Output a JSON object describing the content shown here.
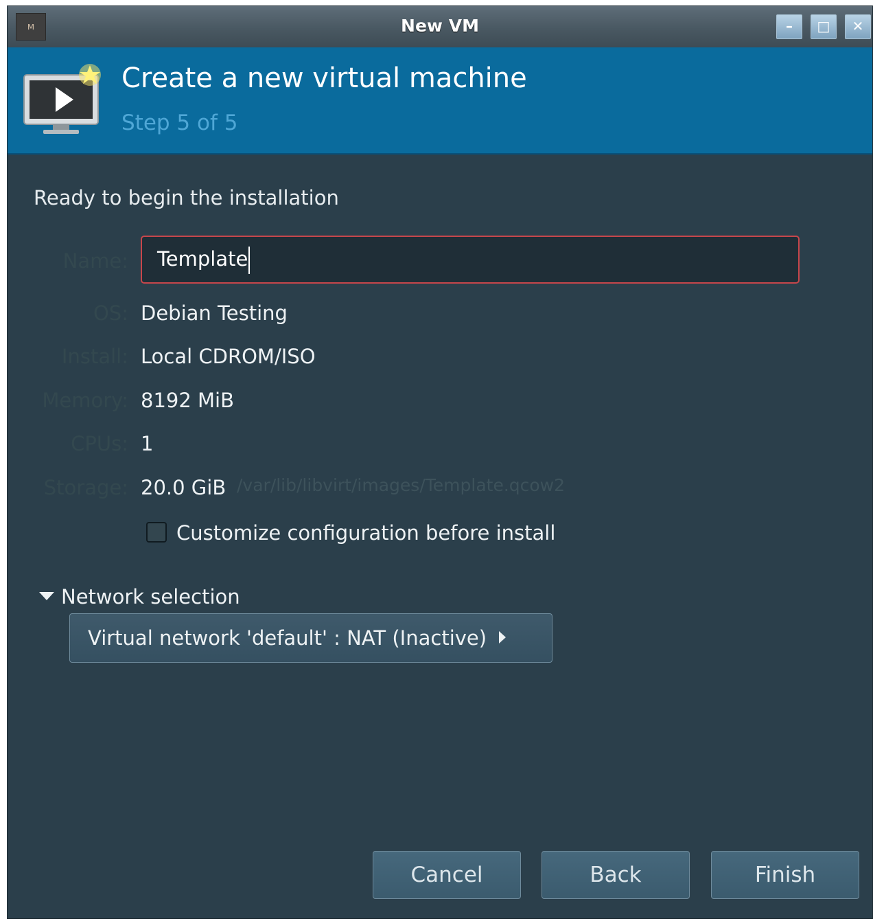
{
  "window": {
    "title": "New VM",
    "app_icon": "virt-manager-icon",
    "controls": {
      "minimize": "minimize-icon",
      "maximize": "maximize-icon",
      "close": "close-icon"
    }
  },
  "header": {
    "title": "Create a new virtual machine",
    "step": "Step 5 of 5",
    "icon": "new-vm-monitor-icon"
  },
  "summary": {
    "heading": "Ready to begin the installation",
    "name_label": "Name:",
    "name_value": "Template",
    "os_label": "OS:",
    "os_value": "Debian Testing",
    "install_label": "Install:",
    "install_value": "Local CDROM/ISO",
    "memory_label": "Memory:",
    "memory_value": "8192 MiB",
    "cpus_label": "CPUs:",
    "cpus_value": "1",
    "storage_label": "Storage:",
    "storage_value": "20.0 GiB",
    "storage_path": "/var/lib/libvirt/images/Template.qcow2",
    "customize_label": "Customize configuration before install",
    "customize_checked": false
  },
  "network": {
    "expander_label": "Network selection",
    "selected": "Virtual network 'default' : NAT (Inactive)"
  },
  "buttons": {
    "cancel": "Cancel",
    "back": "Back",
    "finish": "Finish"
  },
  "colors": {
    "header_bg": "#0a6b9d",
    "body_bg": "#2b3f4b",
    "input_border": "#c7464b"
  }
}
